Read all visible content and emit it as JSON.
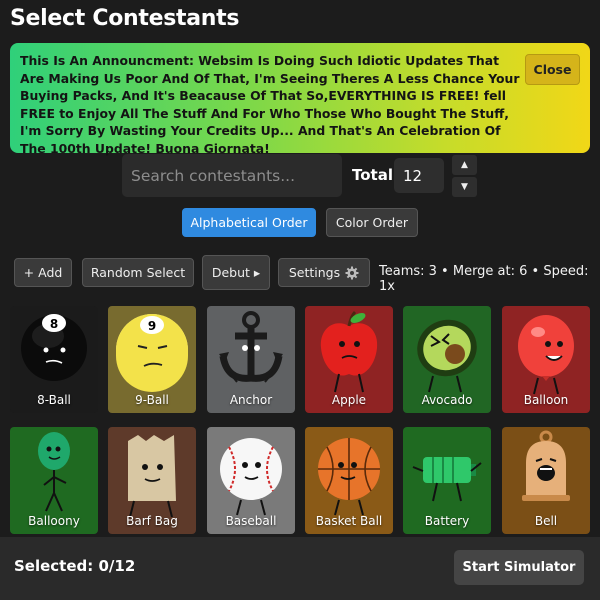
{
  "title": "Select Contestants",
  "announcement": {
    "text": "This Is An Announcment: Websim Is Doing Such Idiotic Updates That Are Making Us Poor And Of That, I'm Seeing Theres A Less Chance Your Buying Packs, And It's Beacause Of That So,EVERYTHING IS FREE! fell FREE to Enjoy All The Stuff And For Who Those Who Bought The Stuff, I'm Sorry By Wasting Your Credits Up... And That's An Celebration Of The 100th Update! Buona Giornata!",
    "close_label": "Close"
  },
  "search": {
    "placeholder": "Search contestants...",
    "value": ""
  },
  "total": {
    "label": "Total:",
    "value": "12"
  },
  "sort": {
    "alphabetical_label": "Alphabetical Order",
    "color_label": "Color Order",
    "active": "alphabetical",
    "active_color": "#2f8ae0"
  },
  "toolbar": {
    "add_label": "+ Add",
    "random_label": "Random Select",
    "debut_label": "Debut ▸",
    "settings_label": "Settings",
    "stats": "Teams: 3 • Merge at: 6 • Speed: 1x"
  },
  "contestants": [
    {
      "name": "8-Ball",
      "bg": "#1b1b1b",
      "icon": "8-ball-icon"
    },
    {
      "name": "9-Ball",
      "bg": "#786b2f",
      "icon": "9-ball-icon"
    },
    {
      "name": "Anchor",
      "bg": "#5f6163",
      "icon": "anchor-icon"
    },
    {
      "name": "Apple",
      "bg": "#8f2323",
      "icon": "apple-icon"
    },
    {
      "name": "Avocado",
      "bg": "#216624",
      "icon": "avocado-icon"
    },
    {
      "name": "Balloon",
      "bg": "#8f2323",
      "icon": "balloon-icon"
    },
    {
      "name": "Balloony",
      "bg": "#1f6a21",
      "icon": "balloony-icon"
    },
    {
      "name": "Barf Bag",
      "bg": "#5e3a2a",
      "icon": "barf-bag-icon"
    },
    {
      "name": "Baseball",
      "bg": "#7a7a7a",
      "icon": "baseball-icon"
    },
    {
      "name": "Basket Ball",
      "bg": "#8a5a17",
      "icon": "basketball-icon"
    },
    {
      "name": "Battery",
      "bg": "#1f6a21",
      "icon": "battery-icon"
    },
    {
      "name": "Bell",
      "bg": "#7b4f16",
      "icon": "bell-icon"
    }
  ],
  "footer": {
    "selected_text": "Selected: 0/12",
    "start_label": "Start Simulator"
  }
}
